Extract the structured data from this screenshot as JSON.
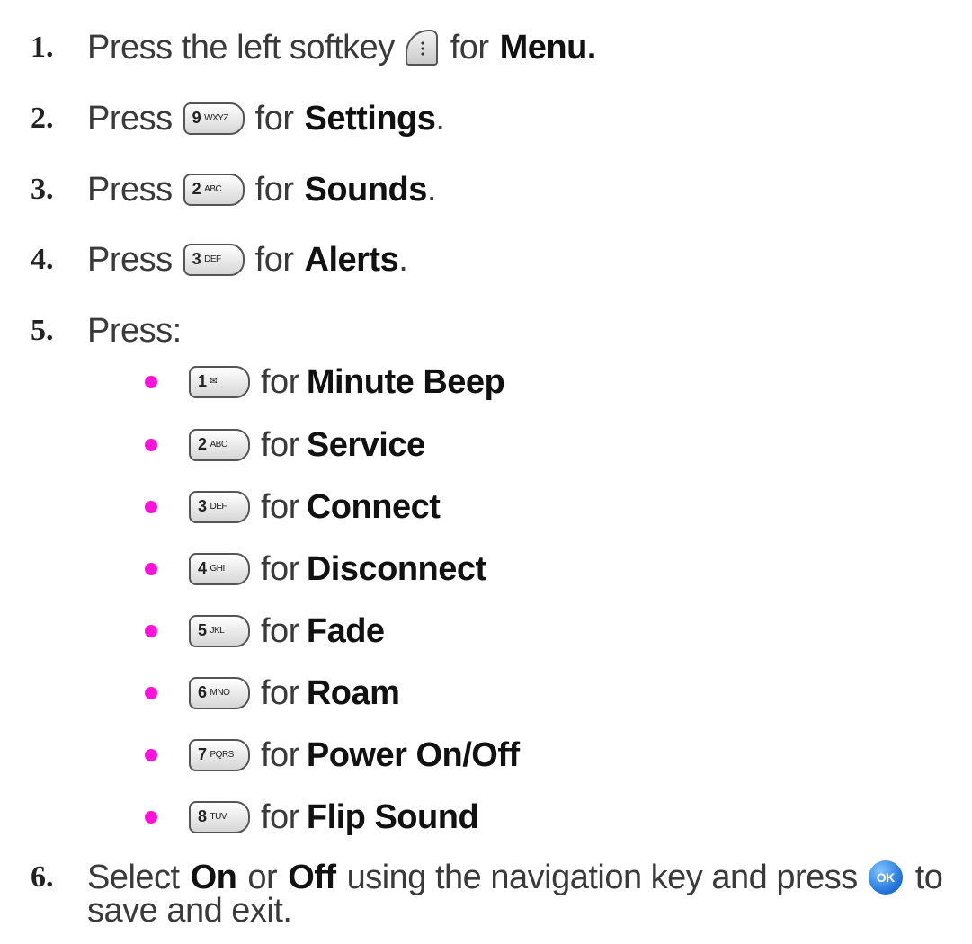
{
  "steps": [
    {
      "num": "1.",
      "pre": "Press the left softkey",
      "key": "softkey-left",
      "post": "for",
      "bold": "Menu."
    },
    {
      "num": "2.",
      "pre": "Press",
      "key": "9wxyz-key",
      "key_num": "9",
      "key_letters": "WXYZ",
      "post": "for",
      "bold": "Settings",
      "tail": "."
    },
    {
      "num": "3.",
      "pre": "Press",
      "key": "2abc-key",
      "key_num": "2",
      "key_letters": "ABC",
      "post": "for",
      "bold": "Sounds",
      "tail": "."
    },
    {
      "num": "4.",
      "pre": "Press",
      "key": "3def-key",
      "key_num": "3",
      "key_letters": "DEF",
      "post": "for",
      "bold": "Alerts",
      "tail": "."
    },
    {
      "num": "5.",
      "pre": "Press:"
    }
  ],
  "sub_items": [
    {
      "key_num": "1",
      "key_letters": "✉",
      "post": "for",
      "bold": "Minute Beep"
    },
    {
      "key_num": "2",
      "key_letters": "ABC",
      "post": "for",
      "bold": "Service"
    },
    {
      "key_num": "3",
      "key_letters": "DEF",
      "post": "for",
      "bold": "Connect"
    },
    {
      "key_num": "4",
      "key_letters": "GHI",
      "post": "for",
      "bold": "Disconnect"
    },
    {
      "key_num": "5",
      "key_letters": "JKL",
      "post": "for",
      "bold": "Fade"
    },
    {
      "key_num": "6",
      "key_letters": "MNO",
      "post": "for",
      "bold": "Roam"
    },
    {
      "key_num": "7",
      "key_letters": "PQRS",
      "post": "for",
      "bold": "Power On/Off"
    },
    {
      "key_num": "8",
      "key_letters": "TUV",
      "post": "for",
      "bold": "Flip Sound"
    }
  ],
  "step6": {
    "num": "6.",
    "pre": "Select",
    "on": "On",
    "or": "or",
    "off": "Off",
    "mid": "using the navigation key and press",
    "ok_label": "OK",
    "post": "to",
    "line2": "save and exit."
  },
  "colors": {
    "bullet": "#ff13d8",
    "ok": "#1d6fd8"
  }
}
